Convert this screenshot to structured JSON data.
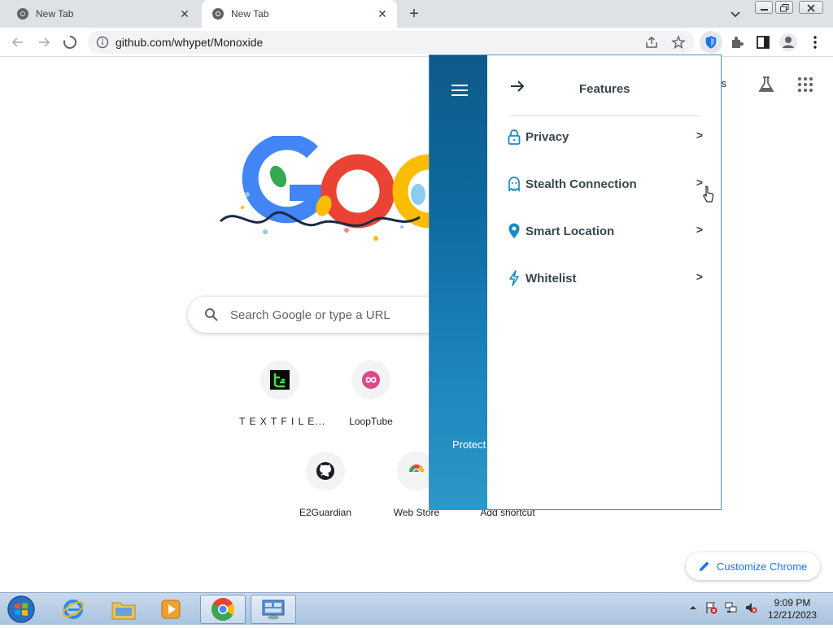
{
  "browser": {
    "tabs": [
      {
        "title": "New Tab",
        "active": false
      },
      {
        "title": "New Tab",
        "active": true
      }
    ],
    "url": "github.com/whypet/Monoxide"
  },
  "ntp": {
    "images_link": "ges",
    "search_placeholder": "Search Google or type a URL",
    "shortcuts": [
      {
        "label": "T E X T F I L E...",
        "icon": "textfile-icon"
      },
      {
        "label": "LoopTube",
        "icon": "looptube-icon"
      },
      {
        "label": "E2Guardian",
        "icon": "github-icon"
      },
      {
        "label": "Web Store",
        "icon": "chrome-webstore-icon"
      },
      {
        "label": "Add shortcut",
        "icon": "add-icon"
      }
    ],
    "customize_label": "Customize Chrome"
  },
  "extension_popup": {
    "title": "Features",
    "footer_text": "Protect",
    "features": [
      {
        "label": "Privacy",
        "icon": "lock-icon",
        "chevron": ">"
      },
      {
        "label": "Stealth Connection",
        "icon": "ghost-icon",
        "chevron": ">"
      },
      {
        "label": "Smart Location",
        "icon": "location-pin-icon",
        "chevron": ">"
      },
      {
        "label": "Whitelist",
        "icon": "lightning-icon",
        "chevron": ">"
      }
    ],
    "accent_color": "#0f6aa0"
  },
  "taskbar": {
    "time": "9:09 PM",
    "date": "12/21/2023"
  }
}
